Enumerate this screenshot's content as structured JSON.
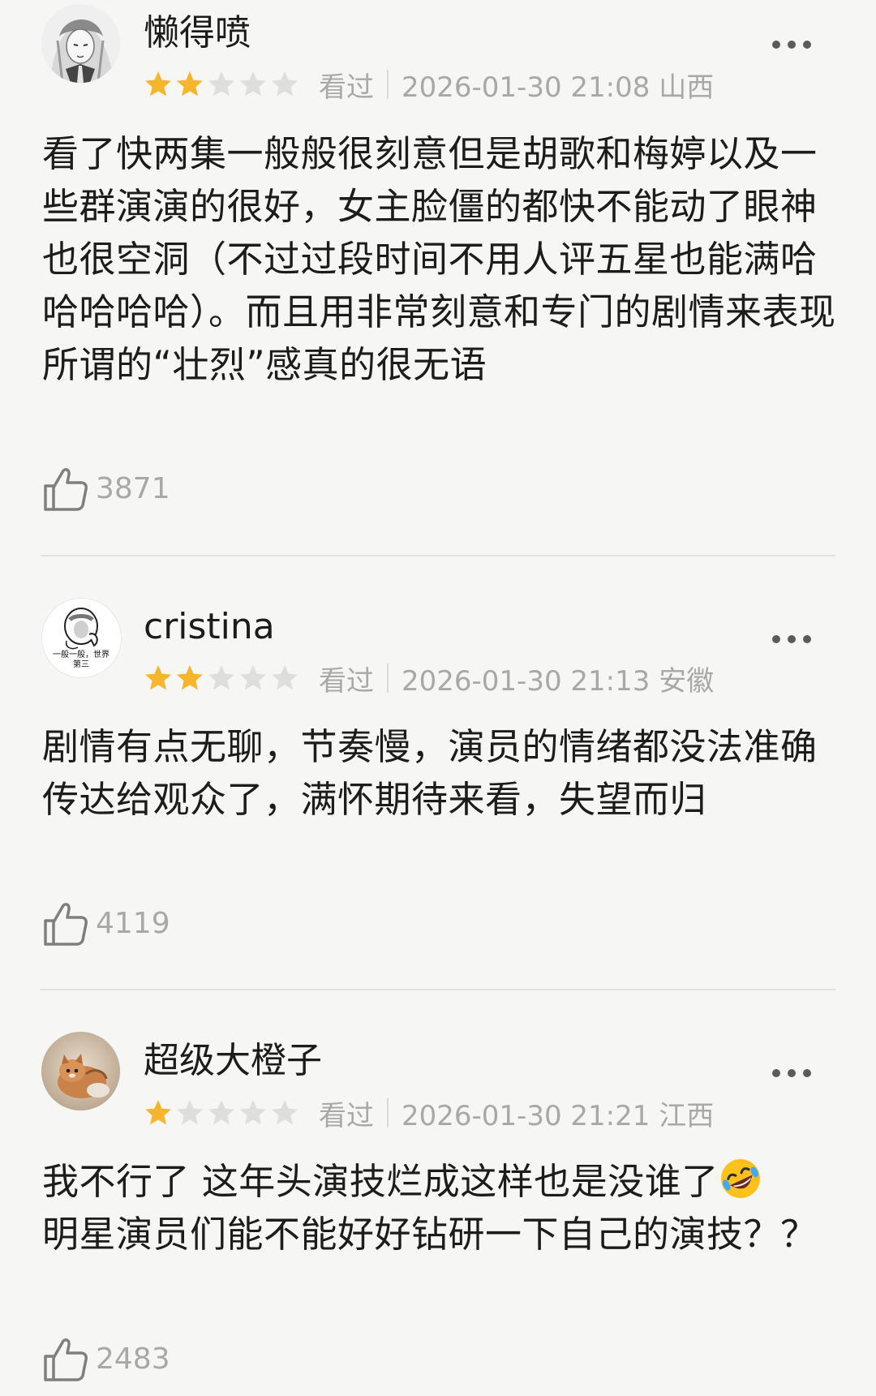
{
  "colors": {
    "star_filled": "#f7b52c",
    "star_empty": "#dedede",
    "meta_text": "#a8a8a8",
    "divider": "#e1e1e1",
    "background": "#f6f6f4"
  },
  "comments": [
    {
      "username": "懒得喷",
      "rating": 2,
      "rating_max": 5,
      "status": "看过",
      "time": "2026-01-30 21:08 山西",
      "text": "看了快两集一般般很刻意但是胡歌和梅婷以及一些群演演的很好，女主脸僵的都快不能动了眼神也很空洞（不过过段时间不用人评五星也能满哈哈哈哈哈）。而且用非常刻意和专门的剧情来表现所谓的“壮烈”感真的很无语",
      "likes": "3871",
      "avatar_icon": "anime-avatar"
    },
    {
      "username": "cristina",
      "rating": 2,
      "rating_max": 5,
      "status": "看过",
      "time": "2026-01-30 21:13 安徽",
      "text": "剧情有点无聊，节奏慢，演员的情绪都没法准确传达给观众了，满怀期待来看，失望而归",
      "likes": "4119",
      "avatar_icon": "meme-avatar",
      "avatar_caption_1": "一般一般，世界",
      "avatar_caption_2": "第三"
    },
    {
      "username": "超级大橙子",
      "rating": 1,
      "rating_max": 5,
      "status": "看过",
      "time": "2026-01-30 21:21 江西",
      "text": "我不行了 这年头演技烂成这样也是没谁了",
      "text_after_emoji": "明星演员们能不能好好钻研一下自己的演技？？",
      "emoji": "rolling-on-floor-laughing-emoji",
      "likes": "2483",
      "avatar_icon": "cat-avatar"
    }
  ]
}
